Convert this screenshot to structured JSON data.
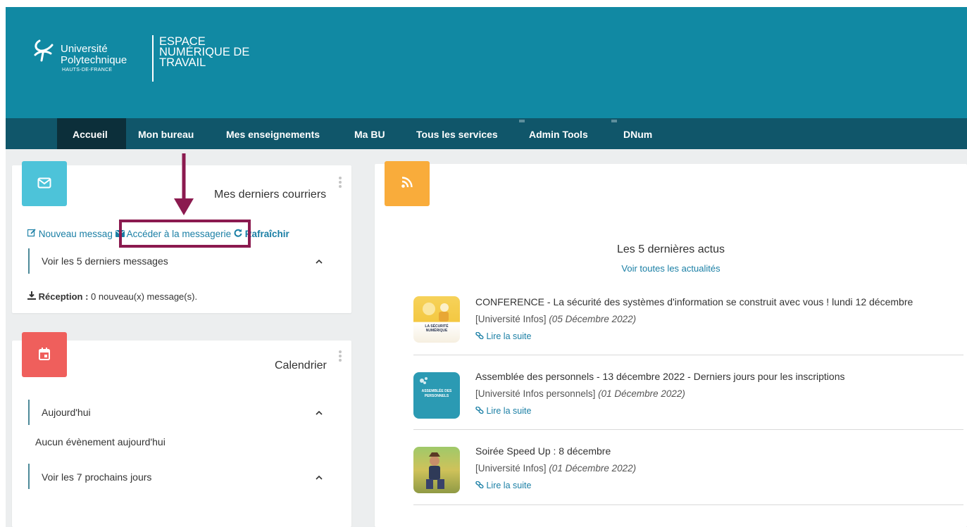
{
  "header": {
    "university_line1": "Université",
    "university_line2": "Polytechnique",
    "university_region": "HAUTS-DE-FRANCE",
    "ent_line1": "ESPACE",
    "ent_line2": "NUMÉRIQUE DE",
    "ent_line3": "TRAVAIL"
  },
  "nav": {
    "items": [
      {
        "label": "Accueil",
        "active": true
      },
      {
        "label": "Mon bureau"
      },
      {
        "label": "Mes enseignements"
      },
      {
        "label": "Ma BU"
      },
      {
        "label": "Tous les services"
      },
      {
        "label": "Admin Tools"
      },
      {
        "label": "DNum"
      }
    ]
  },
  "mail": {
    "title": "Mes derniers courriers",
    "new_message": "Nouveau messag",
    "open_mail": "Accéder à la messagerie",
    "refresh": "Rafraîchir",
    "last_messages": "Voir les 5 derniers messages",
    "inbox_label": "Réception :",
    "inbox_text": "0 nouveau(x) message(s).",
    "icon": "envelope-icon",
    "color": "#4dc3d9"
  },
  "calendar": {
    "title": "Calendrier",
    "today": "Aujourd'hui",
    "no_event": "Aucun évènement aujourd'hui",
    "next_days": "Voir les 7 prochains jours",
    "icon": "calendar-icon",
    "color": "#ef5f5c"
  },
  "news": {
    "icon": "rss-icon",
    "color": "#f9ac3b",
    "heading": "Les 5 dernières actus",
    "see_all": "Voir toutes les actualités",
    "read_more": "Lire la suite",
    "items": [
      {
        "title": "CONFERENCE - La sécurité des systèmes d'information se construit avec vous ! lundi 12 décembre",
        "source": "[Université Infos]",
        "date": "(05 Décembre 2022)",
        "thumb_text": "LA SÉCURITÉ NUMÉRIQUE"
      },
      {
        "title": "Assemblée des personnels - 13 décembre 2022 - Derniers jours pour les inscriptions",
        "source": "[Université Infos personnels]",
        "date": "(01 Décembre 2022)",
        "thumb_text": "ASSEMBLÉE DES PERSONNELS"
      },
      {
        "title": "Soirée Speed Up : 8 décembre",
        "source": "[Université Infos]",
        "date": "(01 Décembre 2022)"
      }
    ]
  },
  "annotation": {
    "color": "#8b1a4f"
  }
}
